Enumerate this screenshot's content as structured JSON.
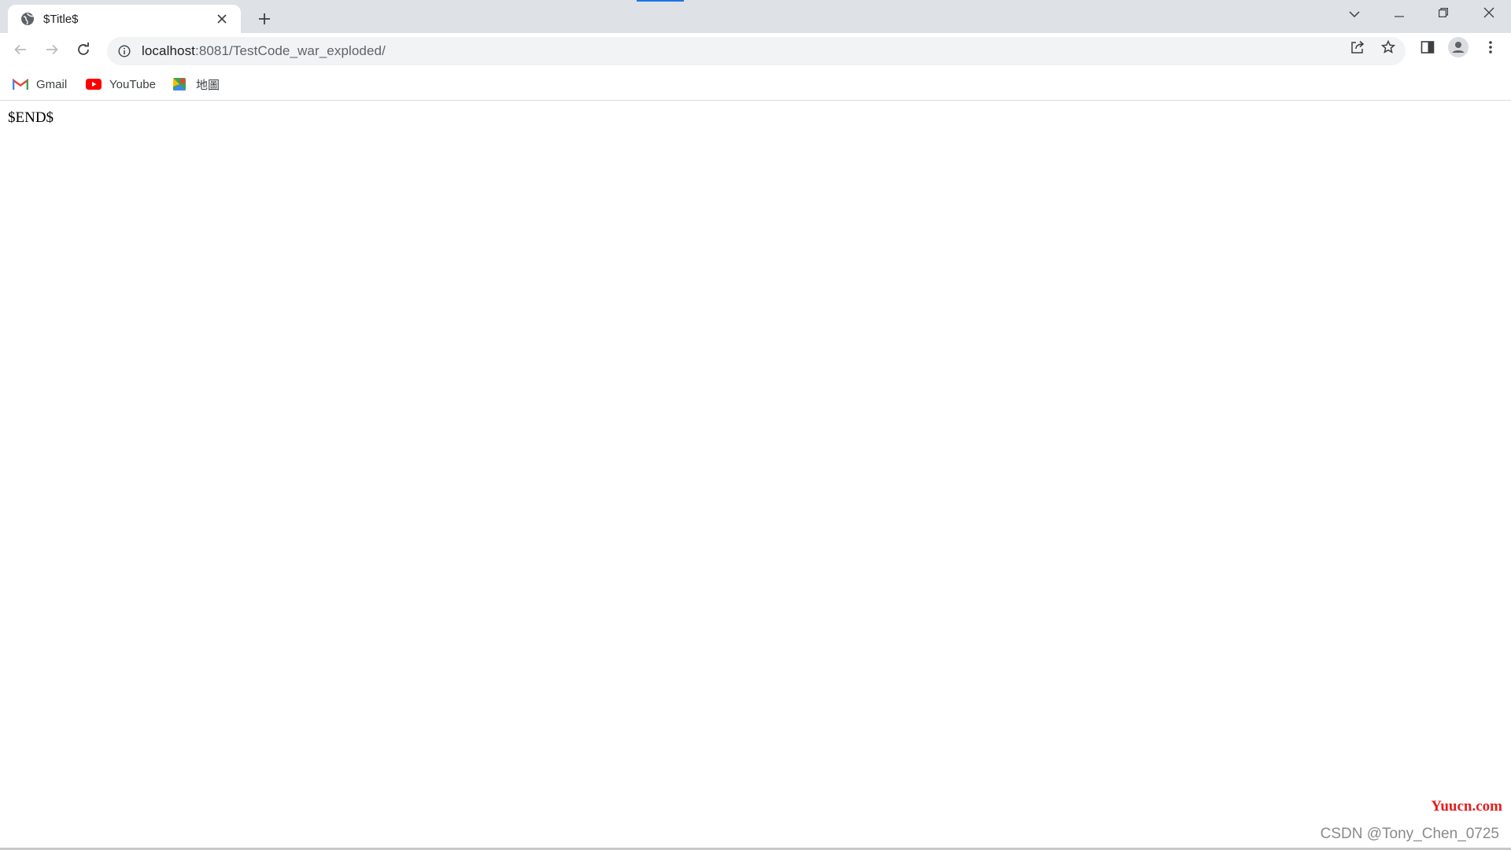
{
  "tab": {
    "title": "$Title$",
    "favicon": "globe-icon",
    "close": "close-icon"
  },
  "toolbar": {
    "address": {
      "host": "localhost",
      "rest": ":8081/TestCode_war_exploded/"
    },
    "icons": [
      "back-icon",
      "forward-icon",
      "reload-icon",
      "site-info-icon",
      "share-icon",
      "bookmark-star-icon",
      "side-panel-icon",
      "profile-icon",
      "menu-icon"
    ]
  },
  "bookmarks": [
    {
      "label": "Gmail",
      "icon": "gmail-icon"
    },
    {
      "label": "YouTube",
      "icon": "youtube-icon"
    },
    {
      "label": "地圖",
      "icon": "maps-icon"
    }
  ],
  "page": {
    "text": "$END$"
  },
  "watermarks": {
    "site": "Yuucn.com",
    "author": "CSDN @Tony_Chen_0725"
  },
  "colors": {
    "accent": "#1a73e8",
    "tabstrip": "#dee1e6",
    "omnibox": "#f1f3f4",
    "watermark_red": "#e41e1e"
  }
}
